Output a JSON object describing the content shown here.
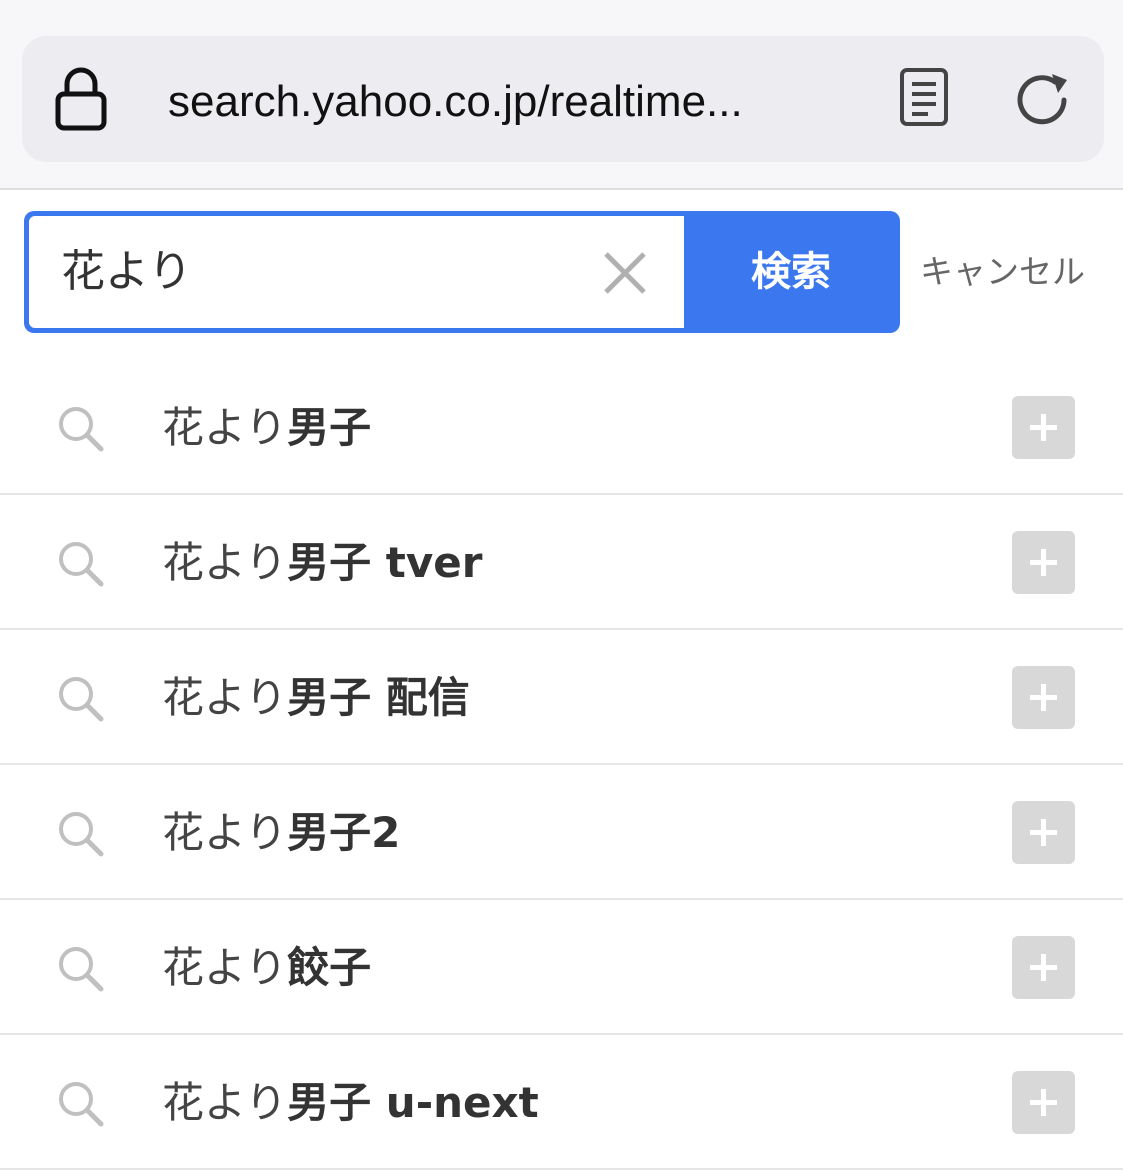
{
  "browser": {
    "url": "search.yahoo.co.jp/realtime..."
  },
  "search": {
    "query": "花より",
    "button_label": "検索",
    "cancel_label": "キャンセル"
  },
  "suggestions": [
    {
      "prefix": "花より",
      "suffix": "男子"
    },
    {
      "prefix": "花より",
      "suffix": "男子 tver"
    },
    {
      "prefix": "花より",
      "suffix": "男子 配信"
    },
    {
      "prefix": "花より",
      "suffix": "男子2"
    },
    {
      "prefix": "花より",
      "suffix": "餃子"
    },
    {
      "prefix": "花より",
      "suffix": "男子 u-next"
    }
  ],
  "icons": {
    "lock": "lock-icon",
    "reader": "reader-mode-icon",
    "reload": "reload-icon",
    "clear": "clear-icon",
    "suggest": "search-icon",
    "add": "plus-icon"
  },
  "colors": {
    "accent": "#3b78f0",
    "add_button": "#d8d8d8"
  }
}
